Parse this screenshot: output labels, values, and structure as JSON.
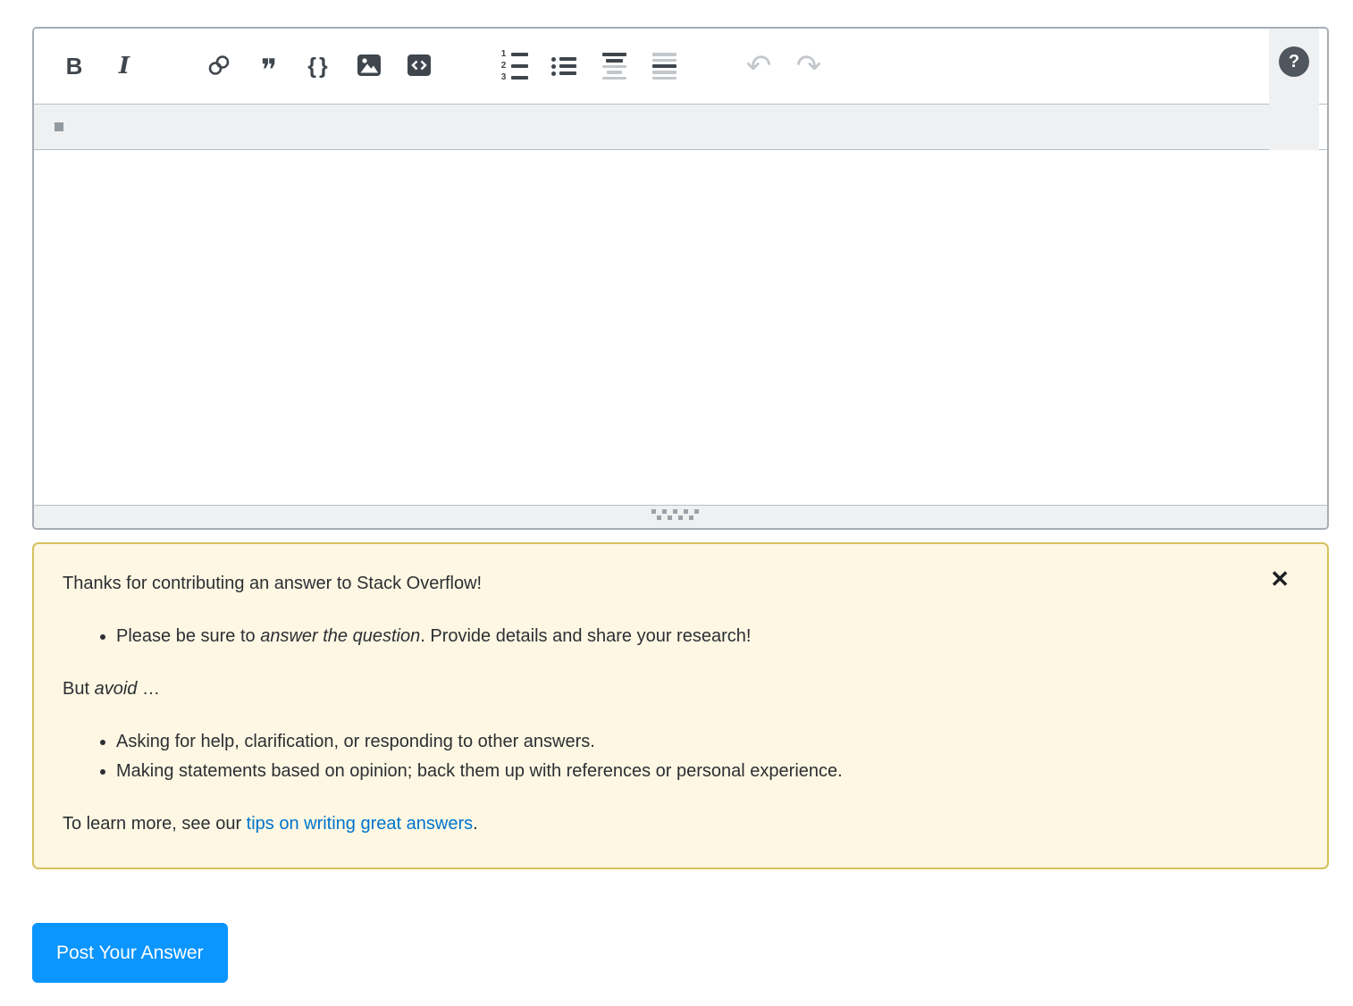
{
  "colors": {
    "accent_blue": "#0a95ff",
    "link_blue": "#0074cc",
    "notice_bg": "#fdf7e3",
    "notice_border": "#d5c15c",
    "icon_dark": "#3f464d",
    "icon_light": "#c3c7cb"
  },
  "toolbar": {
    "bold_label": "B",
    "italic_label": "I",
    "quote_glyph": "❞",
    "braces_label": "{}",
    "undo_glyph": "↶",
    "redo_glyph": "↷",
    "help_label": "?",
    "ol_digits": [
      "1",
      "2",
      "3"
    ]
  },
  "editor": {
    "body_text": ""
  },
  "notice": {
    "title": "Thanks for contributing an answer to Stack Overflow!",
    "tip": {
      "pre": "Please be sure to ",
      "em": "answer the question",
      "post": ". Provide details and share your research!"
    },
    "avoid_intro": {
      "pre": "But ",
      "em": "avoid",
      "post": " …"
    },
    "avoid_items": [
      "Asking for help, clarification, or responding to other answers.",
      "Making statements based on opinion; back them up with references or personal experience."
    ],
    "learn_more": {
      "pre": "To learn more, see our ",
      "link": "tips on writing great answers",
      "post": "."
    },
    "close_glyph": "✕"
  },
  "post_button": {
    "label": "Post Your Answer"
  }
}
